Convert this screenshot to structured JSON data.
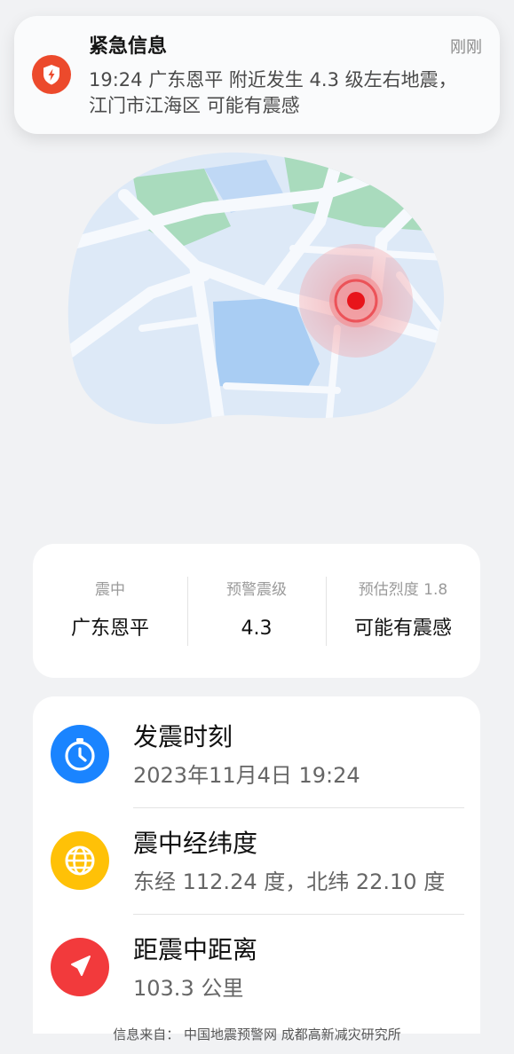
{
  "notification": {
    "title": "紧急信息",
    "time": "刚刚",
    "body": "19:24 广东恩平 附近发生 4.3 级左右地震，江门市江海区 可能有震感",
    "icon": "alert-shield-icon",
    "icon_color": "#ec4a2c"
  },
  "map": {
    "epicenter_marker": "epicenter-marker-icon",
    "marker_color": "#e8141b"
  },
  "summary": {
    "epicenter_label": "震中",
    "epicenter_value": "广东恩平",
    "magnitude_label": "预警震级",
    "magnitude_value": "4.3",
    "intensity_label": "预估烈度 1.8",
    "intensity_value": "可能有震感"
  },
  "details": [
    {
      "title": "发震时刻",
      "value": "2023年11月4日 19:24",
      "icon": "clock-icon",
      "icon_color": "#1a84ff"
    },
    {
      "title": "震中经纬度",
      "value": "东经 112.24 度，北纬 22.10 度",
      "icon": "globe-icon",
      "icon_color": "#ffc107"
    },
    {
      "title": "距震中距离",
      "value": "103.3 公里",
      "icon": "navigation-arrow-icon",
      "icon_color": "#f23a3c"
    }
  ],
  "footer": {
    "source": "信息来自：  中国地震预警网 成都高新减灾研究所"
  }
}
